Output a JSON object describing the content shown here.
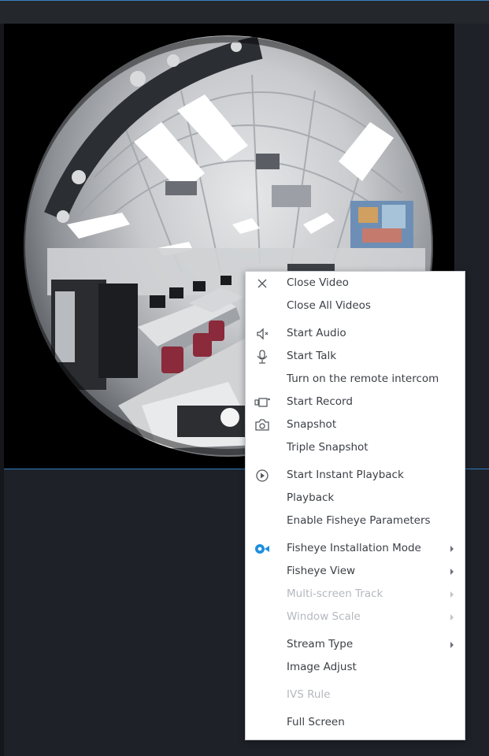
{
  "video": {},
  "context_menu": {
    "items": [
      {
        "label": "Close Video",
        "icon": "close-icon",
        "disabled": false
      },
      {
        "label": "Close All Videos",
        "icon": "",
        "disabled": false
      },
      {
        "label": "Start Audio",
        "icon": "speaker-icon",
        "disabled": false
      },
      {
        "label": "Start Talk",
        "icon": "microphone-icon",
        "disabled": false
      },
      {
        "label": "Turn on the remote intercom",
        "icon": "",
        "disabled": false
      },
      {
        "label": "Start Record",
        "icon": "record-icon",
        "disabled": false
      },
      {
        "label": "Snapshot",
        "icon": "camera-icon",
        "disabled": false
      },
      {
        "label": "Triple Snapshot",
        "icon": "",
        "disabled": false
      },
      {
        "label": "Start Instant Playback",
        "icon": "play-circle-icon",
        "disabled": false
      },
      {
        "label": "Playback",
        "icon": "",
        "disabled": false
      },
      {
        "label": "Enable Fisheye Parameters",
        "icon": "",
        "disabled": false
      },
      {
        "label": "Fisheye Installation Mode",
        "icon": "fisheye-camera-icon",
        "disabled": false,
        "submenu": true
      },
      {
        "label": "Fisheye View",
        "icon": "",
        "disabled": false,
        "submenu": true
      },
      {
        "label": "Multi-screen Track",
        "icon": "",
        "disabled": true,
        "submenu": true
      },
      {
        "label": "Window Scale",
        "icon": "",
        "disabled": true,
        "submenu": true
      },
      {
        "label": "Stream Type",
        "icon": "",
        "disabled": false,
        "submenu": true
      },
      {
        "label": "Image Adjust",
        "icon": "",
        "disabled": false
      },
      {
        "label": "IVS Rule",
        "icon": "",
        "disabled": true
      },
      {
        "label": "Full Screen",
        "icon": "",
        "disabled": false
      }
    ]
  },
  "colors": {
    "accent": "#2f7bc2",
    "fisheye_icon": "#1e8fe0",
    "menu_text": "#3b3f45",
    "menu_disabled": "#b4b8be"
  }
}
